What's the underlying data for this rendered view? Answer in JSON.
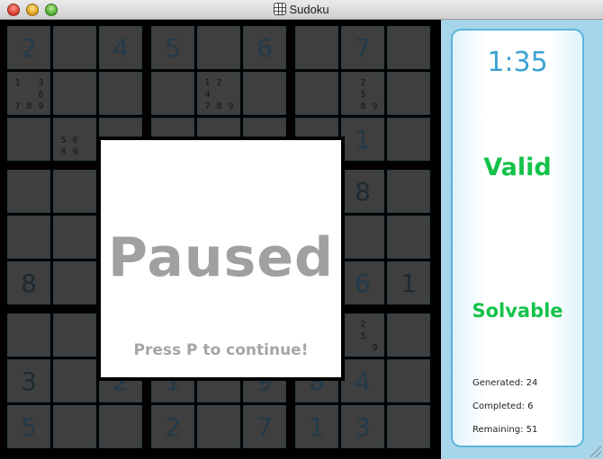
{
  "window": {
    "title": "Sudoku"
  },
  "board": {
    "rows": [
      [
        {
          "v": "2",
          "t": "user"
        },
        {
          "v": "",
          "t": ""
        },
        {
          "v": "4",
          "t": "user"
        },
        {
          "v": "5",
          "t": "user"
        },
        {
          "v": "",
          "t": ""
        },
        {
          "v": "6",
          "t": "user"
        },
        {
          "v": "",
          "t": ""
        },
        {
          "v": "7",
          "t": "user"
        },
        {
          "v": "",
          "t": ""
        }
      ],
      [
        {
          "v": "",
          "t": "",
          "n": [
            "1",
            "",
            "3",
            "",
            "",
            "6",
            "7",
            "8",
            "9"
          ]
        },
        {
          "v": "",
          "t": ""
        },
        {
          "v": "",
          "t": ""
        },
        {
          "v": "",
          "t": ""
        },
        {
          "v": "",
          "t": "",
          "n": [
            "1",
            "2",
            "",
            "4",
            "",
            "",
            "7",
            "8",
            "9"
          ]
        },
        {
          "v": "",
          "t": ""
        },
        {
          "v": "",
          "t": ""
        },
        {
          "v": "",
          "t": "",
          "n": [
            "",
            "2",
            "",
            "",
            "5",
            "",
            "",
            "8",
            "9"
          ]
        },
        {
          "v": "",
          "t": ""
        }
      ],
      [
        {
          "v": "",
          "t": ""
        },
        {
          "v": "",
          "t": "",
          "n": [
            "",
            "",
            "",
            "5",
            "6",
            "",
            "8",
            "9",
            ""
          ]
        },
        {
          "v": "",
          "t": ""
        },
        {
          "v": "",
          "t": ""
        },
        {
          "v": "",
          "t": ""
        },
        {
          "v": "",
          "t": ""
        },
        {
          "v": "",
          "t": ""
        },
        {
          "v": "1",
          "t": "user"
        },
        {
          "v": "",
          "t": ""
        }
      ],
      [
        {
          "v": "",
          "t": ""
        },
        {
          "v": "",
          "t": ""
        },
        {
          "v": "",
          "t": ""
        },
        {
          "v": "",
          "t": ""
        },
        {
          "v": "",
          "t": ""
        },
        {
          "v": "",
          "t": ""
        },
        {
          "v": "",
          "t": ""
        },
        {
          "v": "8",
          "t": "given"
        },
        {
          "v": "",
          "t": ""
        }
      ],
      [
        {
          "v": "",
          "t": ""
        },
        {
          "v": "",
          "t": ""
        },
        {
          "v": "",
          "t": ""
        },
        {
          "v": "",
          "t": ""
        },
        {
          "v": "",
          "t": ""
        },
        {
          "v": "",
          "t": ""
        },
        {
          "v": "",
          "t": ""
        },
        {
          "v": "",
          "t": ""
        },
        {
          "v": "",
          "t": ""
        }
      ],
      [
        {
          "v": "8",
          "t": "given"
        },
        {
          "v": "",
          "t": ""
        },
        {
          "v": "",
          "t": ""
        },
        {
          "v": "",
          "t": ""
        },
        {
          "v": "",
          "t": ""
        },
        {
          "v": "",
          "t": ""
        },
        {
          "v": "",
          "t": ""
        },
        {
          "v": "6",
          "t": "user"
        },
        {
          "v": "1",
          "t": "given"
        }
      ],
      [
        {
          "v": "",
          "t": ""
        },
        {
          "v": "",
          "t": ""
        },
        {
          "v": "",
          "t": ""
        },
        {
          "v": "",
          "t": ""
        },
        {
          "v": "",
          "t": ""
        },
        {
          "v": "",
          "t": ""
        },
        {
          "v": "",
          "t": ""
        },
        {
          "v": "",
          "t": "",
          "n": [
            "",
            "2",
            "",
            "",
            "5",
            "",
            "",
            "",
            "9"
          ]
        },
        {
          "v": "",
          "t": ""
        }
      ],
      [
        {
          "v": "3",
          "t": "given"
        },
        {
          "v": "",
          "t": ""
        },
        {
          "v": "2",
          "t": "user"
        },
        {
          "v": "1",
          "t": "user"
        },
        {
          "v": "",
          "t": ""
        },
        {
          "v": "9",
          "t": "user"
        },
        {
          "v": "8",
          "t": "user"
        },
        {
          "v": "4",
          "t": "user"
        },
        {
          "v": "",
          "t": ""
        }
      ],
      [
        {
          "v": "5",
          "t": "user"
        },
        {
          "v": "",
          "t": ""
        },
        {
          "v": "",
          "t": ""
        },
        {
          "v": "2",
          "t": "user"
        },
        {
          "v": "",
          "t": ""
        },
        {
          "v": "7",
          "t": "user"
        },
        {
          "v": "1",
          "t": "user"
        },
        {
          "v": "3",
          "t": "user"
        },
        {
          "v": "",
          "t": ""
        }
      ]
    ]
  },
  "overlay": {
    "title": "Paused",
    "hint": "Press P to continue!"
  },
  "sidebar": {
    "timer": "1:35",
    "validity": "Valid",
    "solvability": "Solvable",
    "generated": "Generated: 24",
    "completed": "Completed: 6",
    "remaining": "Remaining: 51"
  },
  "colors": {
    "panel_bg": "#a7d5ea",
    "card_border": "#5ab6dc",
    "timer": "#3aa3d2",
    "status_green": "#14c34a",
    "paused_text": "#a0a0a0"
  }
}
